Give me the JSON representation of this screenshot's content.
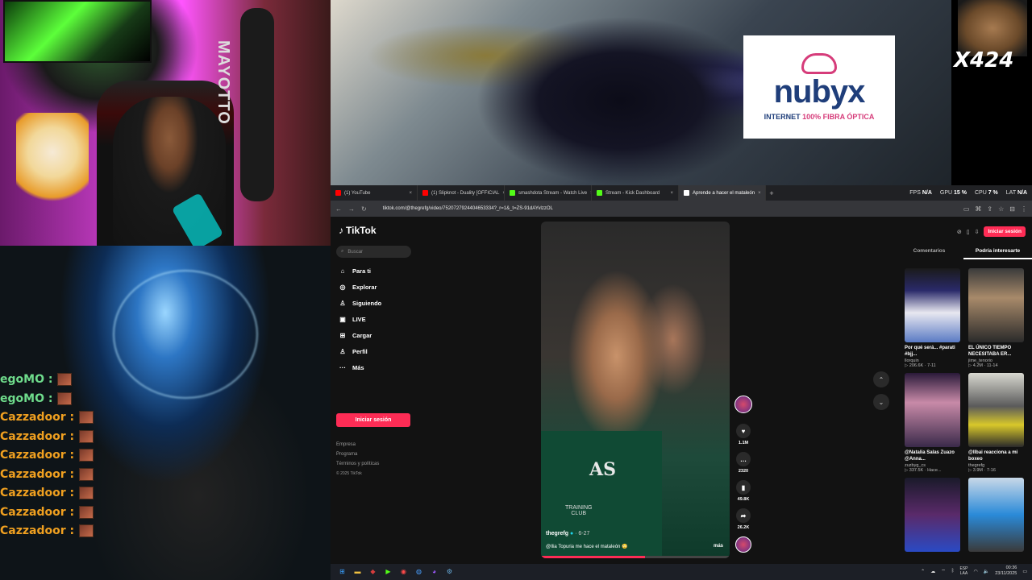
{
  "overlay": {
    "webcam_text": "MAYOTTO",
    "sponsor": {
      "brand": "nubyx",
      "tagline_pre": "INTERNET ",
      "tagline_hl": "100% FIBRA ÓPTICA"
    },
    "meme_multiplier": "X424",
    "chat": [
      {
        "user": "egoMO :",
        "color": "#6fdc8c"
      },
      {
        "user": "egoMO :",
        "color": "#6fdc8c"
      },
      {
        "user": "Cazzadoor :",
        "color": "#f0a020"
      },
      {
        "user": "Cazzadoor :",
        "color": "#f0a020"
      },
      {
        "user": "Cazzadoor :",
        "color": "#f0a020"
      },
      {
        "user": "Cazzadoor :",
        "color": "#f0a020"
      },
      {
        "user": "Cazzadoor :",
        "color": "#f0a020"
      },
      {
        "user": "Cazzadoor :",
        "color": "#f0a020"
      },
      {
        "user": "Cazzadoor :",
        "color": "#f0a020"
      }
    ]
  },
  "browser": {
    "tabs": [
      {
        "title": "(1) YouTube",
        "fav": "#ff0000",
        "close": "×"
      },
      {
        "title": "(1) Slipknot - Duality [OFFICIAL",
        "fav": "#ff0000",
        "close": "×"
      },
      {
        "title": "smashdota Stream - Watch Live",
        "fav": "#53fc18",
        "close": "×"
      },
      {
        "title": "Stream - Kick Dashboard",
        "fav": "#53fc18",
        "close": "×"
      },
      {
        "title": "Aprende a hacer el mataleón",
        "fav": "#ffffff",
        "close": "×"
      }
    ],
    "new_tab": "+",
    "hud": {
      "fps_label": "FPS",
      "fps": "N/A",
      "gpu_label": "GPU",
      "gpu": "15 %",
      "cpu_label": "CPU",
      "cpu": "7 %",
      "lat_label": "LAT",
      "lat": "N/A"
    },
    "url": "tiktok.com/@thegrefg/video/7520727924404653334?_r=1&_t=ZS-91dAYvlzzOL"
  },
  "tiktok": {
    "logo": "TikTok",
    "search_placeholder": "Buscar",
    "menu": [
      {
        "label": "Para ti",
        "icon": "⌂",
        "name": "home-icon"
      },
      {
        "label": "Explorar",
        "icon": "◎",
        "name": "compass-icon"
      },
      {
        "label": "Siguiendo",
        "icon": "♙",
        "name": "following-icon"
      },
      {
        "label": "LIVE",
        "icon": "▣",
        "name": "live-icon"
      },
      {
        "label": "Cargar",
        "icon": "⊞",
        "name": "upload-icon"
      },
      {
        "label": "Perfil",
        "icon": "♙",
        "name": "profile-icon"
      },
      {
        "label": "Más",
        "icon": "···",
        "name": "more-icon"
      }
    ],
    "login": "Iniciar sesión",
    "footer": [
      "Empresa",
      "Programa",
      "Términos y políticas"
    ],
    "copyright": "© 2025 TikTok",
    "video": {
      "jersey": "AS",
      "club": "TRAINING\nCLUB",
      "user": "thegrefg",
      "date": " · 6-27",
      "caption": "@Ilia Topuria me hace el mataleón 😳",
      "more": "más",
      "progress": 0.55
    },
    "actions": {
      "likes": "1.1M",
      "comments": "2320",
      "saves": "49.8K",
      "shares": "26.2K"
    },
    "right": {
      "login": "Iniciar sesión",
      "tabs": [
        "Comentarios",
        "Podría interesarte"
      ],
      "cards": [
        {
          "title": "Por qué será... #parati #bjj...",
          "author": "llorquin",
          "meta": "▷ 206.6K · 7-11",
          "bg": "linear-gradient(180deg,#1a1a1a 0,#2a2a6a 30%,#e8e8f0 60%,#5a7ac4 100%)"
        },
        {
          "title": "EL ÚNICO TIEMPO NECESITABA ER...",
          "author": "jime_tenorio",
          "meta": "▷ 4.2M · 11-14",
          "bg": "linear-gradient(180deg,#3a3a3a 0,#a88a6a 40%,#2a2a2a 100%)"
        },
        {
          "title": "@Natalia Salas Zuazo @Anna...",
          "author": "zuzbyg_cs",
          "meta": "▷ 337.5K · Hace...",
          "bg": "linear-gradient(180deg,#2a1a3a 0,#c88aa8 40%,#3a2a4a 100%)"
        },
        {
          "title": "@Ilbai reacciona a mi boxeo",
          "author": "thegrefg",
          "meta": "▷ 3.9M · 7-16",
          "bg": "linear-gradient(180deg,#d8d8d0 0,#5a5a5a 45%,#d8c82a 70%,#2a2a2a 100%)"
        },
        {
          "title": "",
          "author": "",
          "meta": "",
          "bg": "linear-gradient(180deg,#1a1a2a 0,#5a2a6a 50%,#2a4ac4 100%)"
        },
        {
          "title": "",
          "author": "",
          "meta": "",
          "bg": "linear-gradient(180deg,#c8d8e8 0,#2a8ad8 50%,#3a3a3a 100%)"
        }
      ]
    }
  },
  "taskbar": {
    "lang": "ESP\nLAA",
    "time": "00:36",
    "date": "23/11/2025"
  }
}
